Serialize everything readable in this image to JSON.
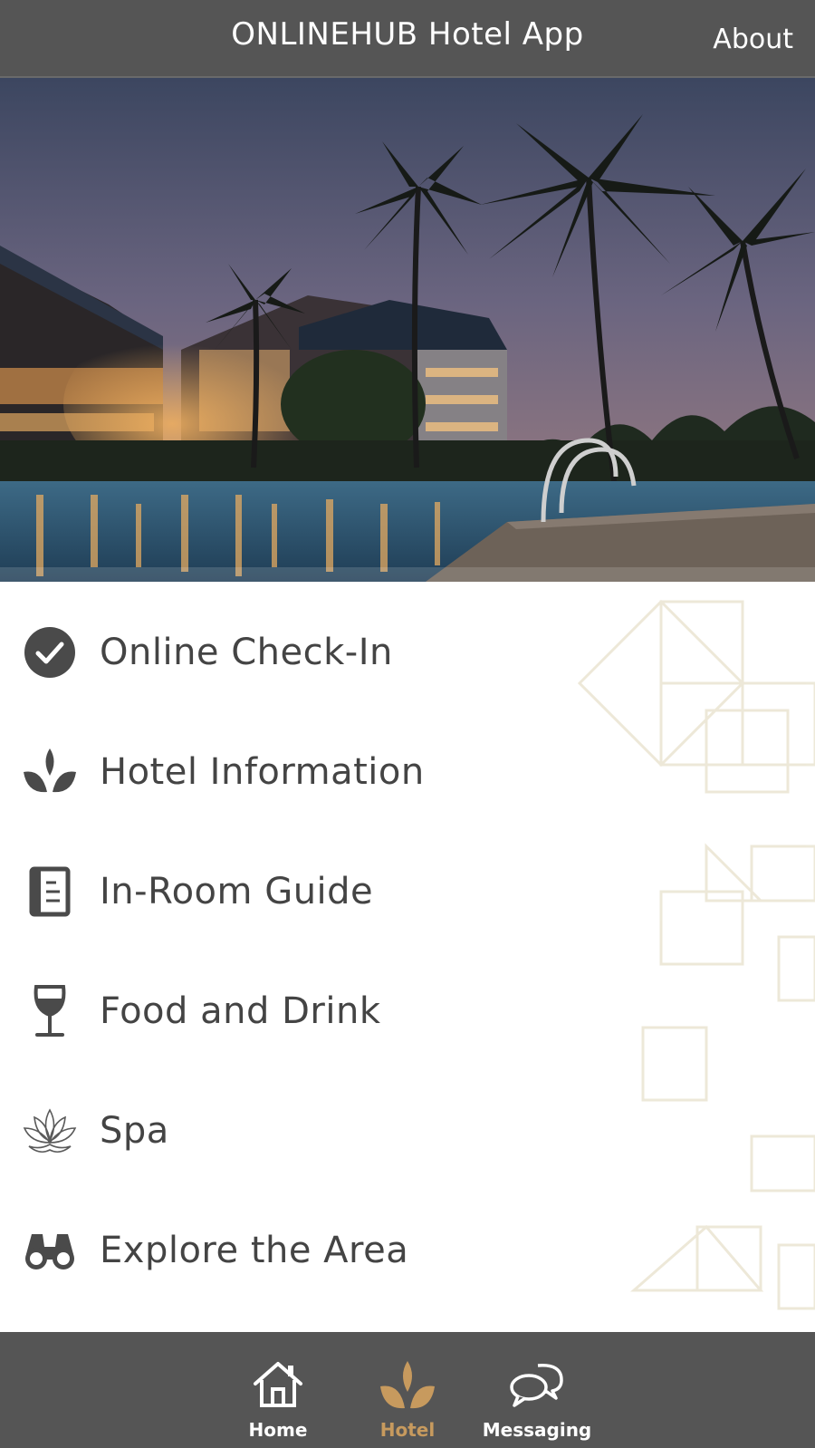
{
  "header": {
    "title": "ONLINEHUB Hotel App",
    "about_label": "About"
  },
  "hero": {
    "image": "tropical-resort-pool-at-dusk"
  },
  "menu": {
    "items": [
      {
        "label": "Online Check-In",
        "icon": "check-circle-icon"
      },
      {
        "label": "Hotel Information",
        "icon": "leaves-icon"
      },
      {
        "label": "In-Room Guide",
        "icon": "document-icon"
      },
      {
        "label": "Food and Drink",
        "icon": "wine-glass-icon"
      },
      {
        "label": "Spa",
        "icon": "lotus-icon"
      },
      {
        "label": "Explore the Area",
        "icon": "binoculars-icon"
      }
    ]
  },
  "bottom_nav": {
    "tabs": [
      {
        "label": "Home",
        "icon": "home-icon",
        "active": false
      },
      {
        "label": "Hotel",
        "icon": "leaves-icon",
        "active": true
      },
      {
        "label": "Messaging",
        "icon": "chat-bubbles-icon",
        "active": false
      }
    ]
  },
  "colors": {
    "header_bg": "#555555",
    "nav_bg": "#555555",
    "accent": "#c79a5e",
    "text": "#444444",
    "icon": "#4a4a4a"
  }
}
